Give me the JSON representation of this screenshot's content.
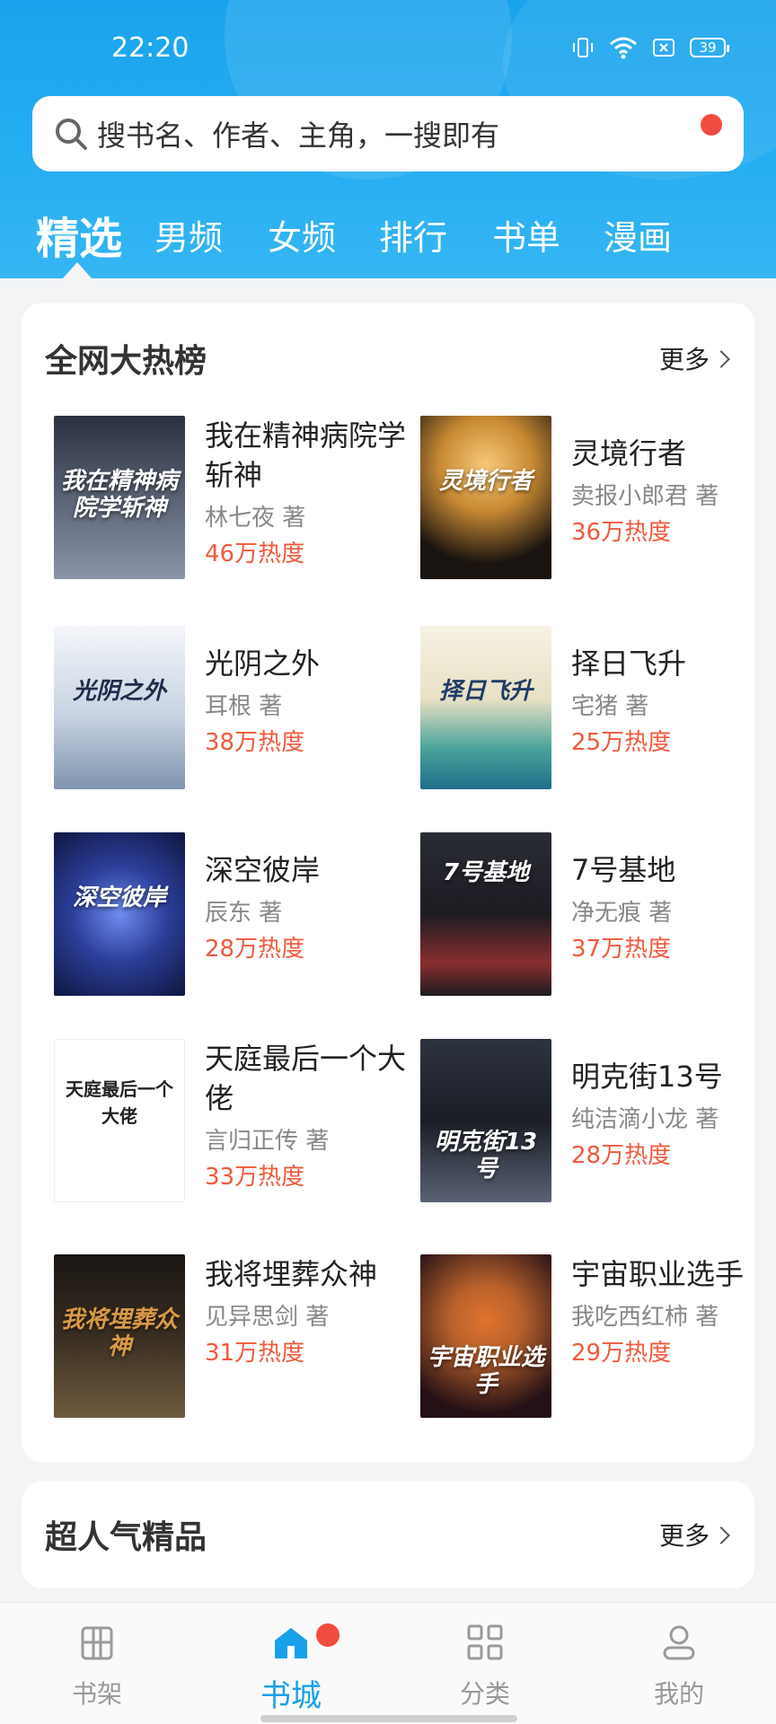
{
  "status": {
    "time": "22:20",
    "battery": "39"
  },
  "search": {
    "placeholder": "搜书名、作者、主角，一搜即有"
  },
  "tabs": [
    {
      "label": "精选",
      "active": true
    },
    {
      "label": "男频",
      "active": false
    },
    {
      "label": "女频",
      "active": false
    },
    {
      "label": "排行",
      "active": false
    },
    {
      "label": "书单",
      "active": false
    },
    {
      "label": "漫画",
      "active": false
    }
  ],
  "hot": {
    "title": "全网大热榜",
    "more": "更多",
    "books": [
      {
        "name": "我在精神病院学斩神",
        "author": "林七夜 著",
        "heat": "46万热度",
        "cover_colors": [
          "#2a3140",
          "#8a95a8"
        ]
      },
      {
        "name": "灵境行者",
        "author": "卖报小郎君 著",
        "heat": "36万热度",
        "cover_colors": [
          "#1a1410",
          "#e0a146"
        ]
      },
      {
        "name": "光阴之外",
        "author": "耳根  著",
        "heat": "38万热度",
        "cover_colors": [
          "#dfe6ef",
          "#8ba0b8"
        ]
      },
      {
        "name": "择日飞升",
        "author": "宅猪 著",
        "heat": "25万热度",
        "cover_colors": [
          "#f3eee0",
          "#4aa39a"
        ]
      },
      {
        "name": "深空彼岸",
        "author": "辰东 著",
        "heat": "28万热度",
        "cover_colors": [
          "#0e1640",
          "#3c53b8"
        ]
      },
      {
        "name": "7号基地",
        "author": "净无痕 著",
        "heat": "37万热度",
        "cover_colors": [
          "#1c1c22",
          "#8a2e2e"
        ]
      },
      {
        "name": "天庭最后一个大佬",
        "author": "言归正传 著",
        "heat": "33万热度",
        "cover_colors": [
          "#ffffff",
          "#f3f3f3"
        ]
      },
      {
        "name": "明克街13号",
        "author": "纯洁滴小龙 著",
        "heat": "28万热度",
        "cover_colors": [
          "#1b1e26",
          "#5a6275"
        ]
      },
      {
        "name": "我将埋葬众神",
        "author": "见异思剑 著",
        "heat": "31万热度",
        "cover_colors": [
          "#1a1614",
          "#6e5b3e"
        ]
      },
      {
        "name": "宇宙职业选手",
        "author": "我吃西红柿 著",
        "heat": "29万热度",
        "cover_colors": [
          "#241015",
          "#b8612c"
        ]
      }
    ]
  },
  "popular": {
    "title": "超人气精品",
    "more": "更多"
  },
  "bottom_nav": [
    {
      "label": "书架",
      "icon": "bookshelf-icon",
      "active": false
    },
    {
      "label": "书城",
      "icon": "home-icon",
      "active": true
    },
    {
      "label": "分类",
      "icon": "grid-icon",
      "active": false
    },
    {
      "label": "我的",
      "icon": "user-icon",
      "active": false
    }
  ],
  "colors": {
    "accent": "#19a0ea",
    "heat": "#ef5a3c",
    "badge": "#f14c3f"
  }
}
